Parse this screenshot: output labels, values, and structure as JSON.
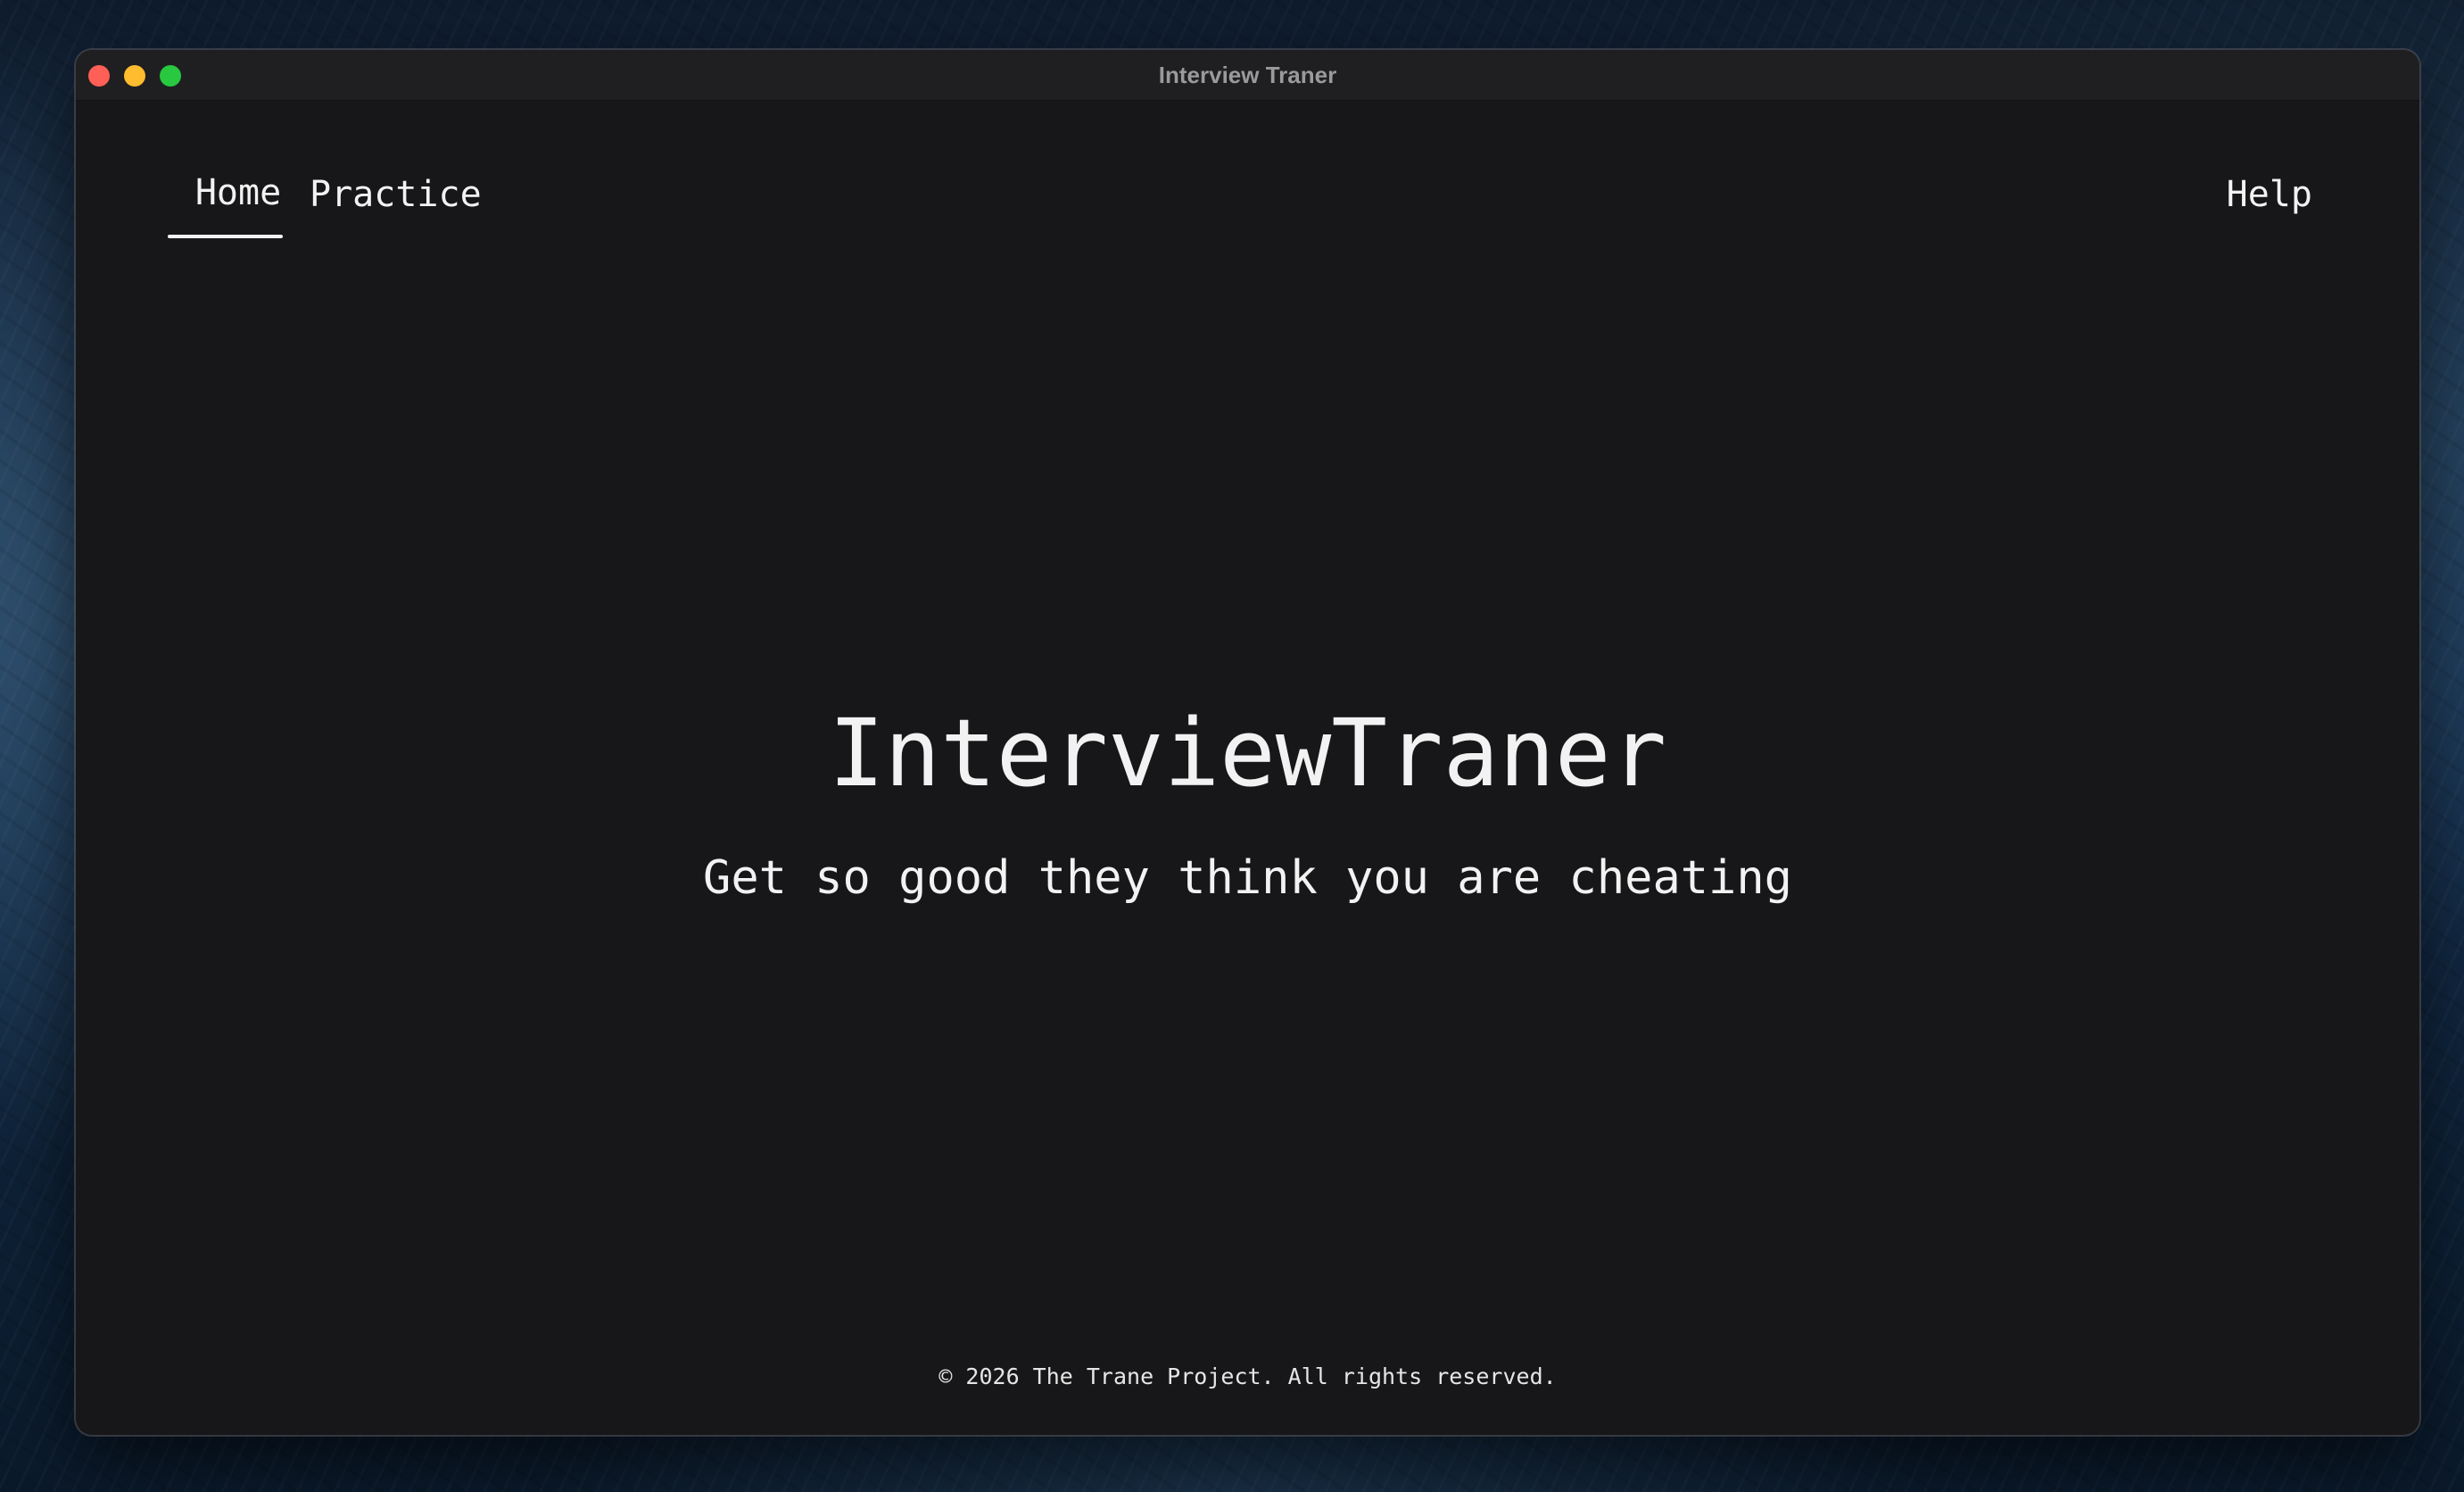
{
  "window": {
    "title": "Interview Traner"
  },
  "nav": {
    "items": [
      {
        "label": "Home",
        "active": true
      },
      {
        "label": "Practice",
        "active": false
      }
    ],
    "help_label": "Help"
  },
  "hero": {
    "title": "InterviewTraner",
    "subtitle": "Get so good they think you are cheating"
  },
  "footer": {
    "text": "© 2026 The Trane Project. All rights reserved."
  },
  "colors": {
    "window_background": "#171719",
    "titlebar": "#1f1f21",
    "text": "#f2f2f2",
    "close": "#fe5f57",
    "minimize": "#febc2e",
    "maximize": "#28c840"
  }
}
